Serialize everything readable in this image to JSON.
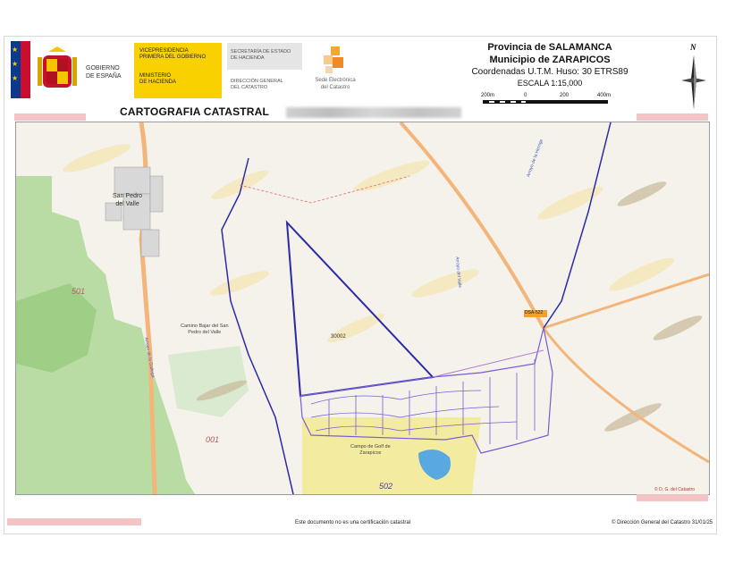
{
  "header": {
    "gov_line1": "GOBIERNO",
    "gov_line2": "DE ESPAÑA",
    "vice_line1": "VICEPRESIDENCIA",
    "vice_line2": "PRIMERA DEL GOBIERNO",
    "min_line1": "MINISTERIO",
    "min_line2": "DE HACIENDA",
    "sec_line1": "SECRETARÍA DE ESTADO",
    "sec_line2": "DE HACIENDA",
    "dir_line1": "DIRECCIÓN GENERAL",
    "dir_line2": "DEL CATASTRO",
    "sede_line1": "Sede Electrónica",
    "sede_line2": "del Catastro"
  },
  "location": {
    "province": "Provincia de SALAMANCA",
    "municipality": "Municipio de ZARAPICOS",
    "coords": "Coordenadas U.T.M. Huso: 30 ETRS89",
    "scale": "ESCALA 1:15,000"
  },
  "scale_bar": {
    "left": "200m",
    "zero": "0",
    "mid": "200",
    "right": "400m"
  },
  "north_arrow": {
    "letter": "N",
    "icon": "compass-north-icon"
  },
  "title": "CARTOGRAFIA CATASTRAL",
  "map": {
    "town_name_1": "San Pedro",
    "town_name_2": "del Valle",
    "polygon_501": "501",
    "polygon_001": "001",
    "polygon_502": "502",
    "parcel_30002": "30002",
    "cemetery_1": "Camino Bajar del San",
    "cemetery_2": "Pedro del Valle",
    "golf_1": "Campo de Golf de",
    "golf_2": "Zarapicos",
    "road_dsa": "DSA-522",
    "road_a": "Arroyo de la Gallega",
    "road_b": "Arroyo de la Herrige",
    "road_c": "Arroyo del Valle",
    "colors": {
      "green": "#b8dca3",
      "boundary": "#2a2aa8",
      "urban": "#7a5bd6",
      "golf": "#f3eca0",
      "water": "#5aa8e0",
      "road": "#f3b57a"
    }
  },
  "footer": {
    "notice": "Este documento no es una certificación catastral",
    "copyright": "© Dirección General del Catastro 31/01/25",
    "credit": "© D. G. del Catastro"
  }
}
